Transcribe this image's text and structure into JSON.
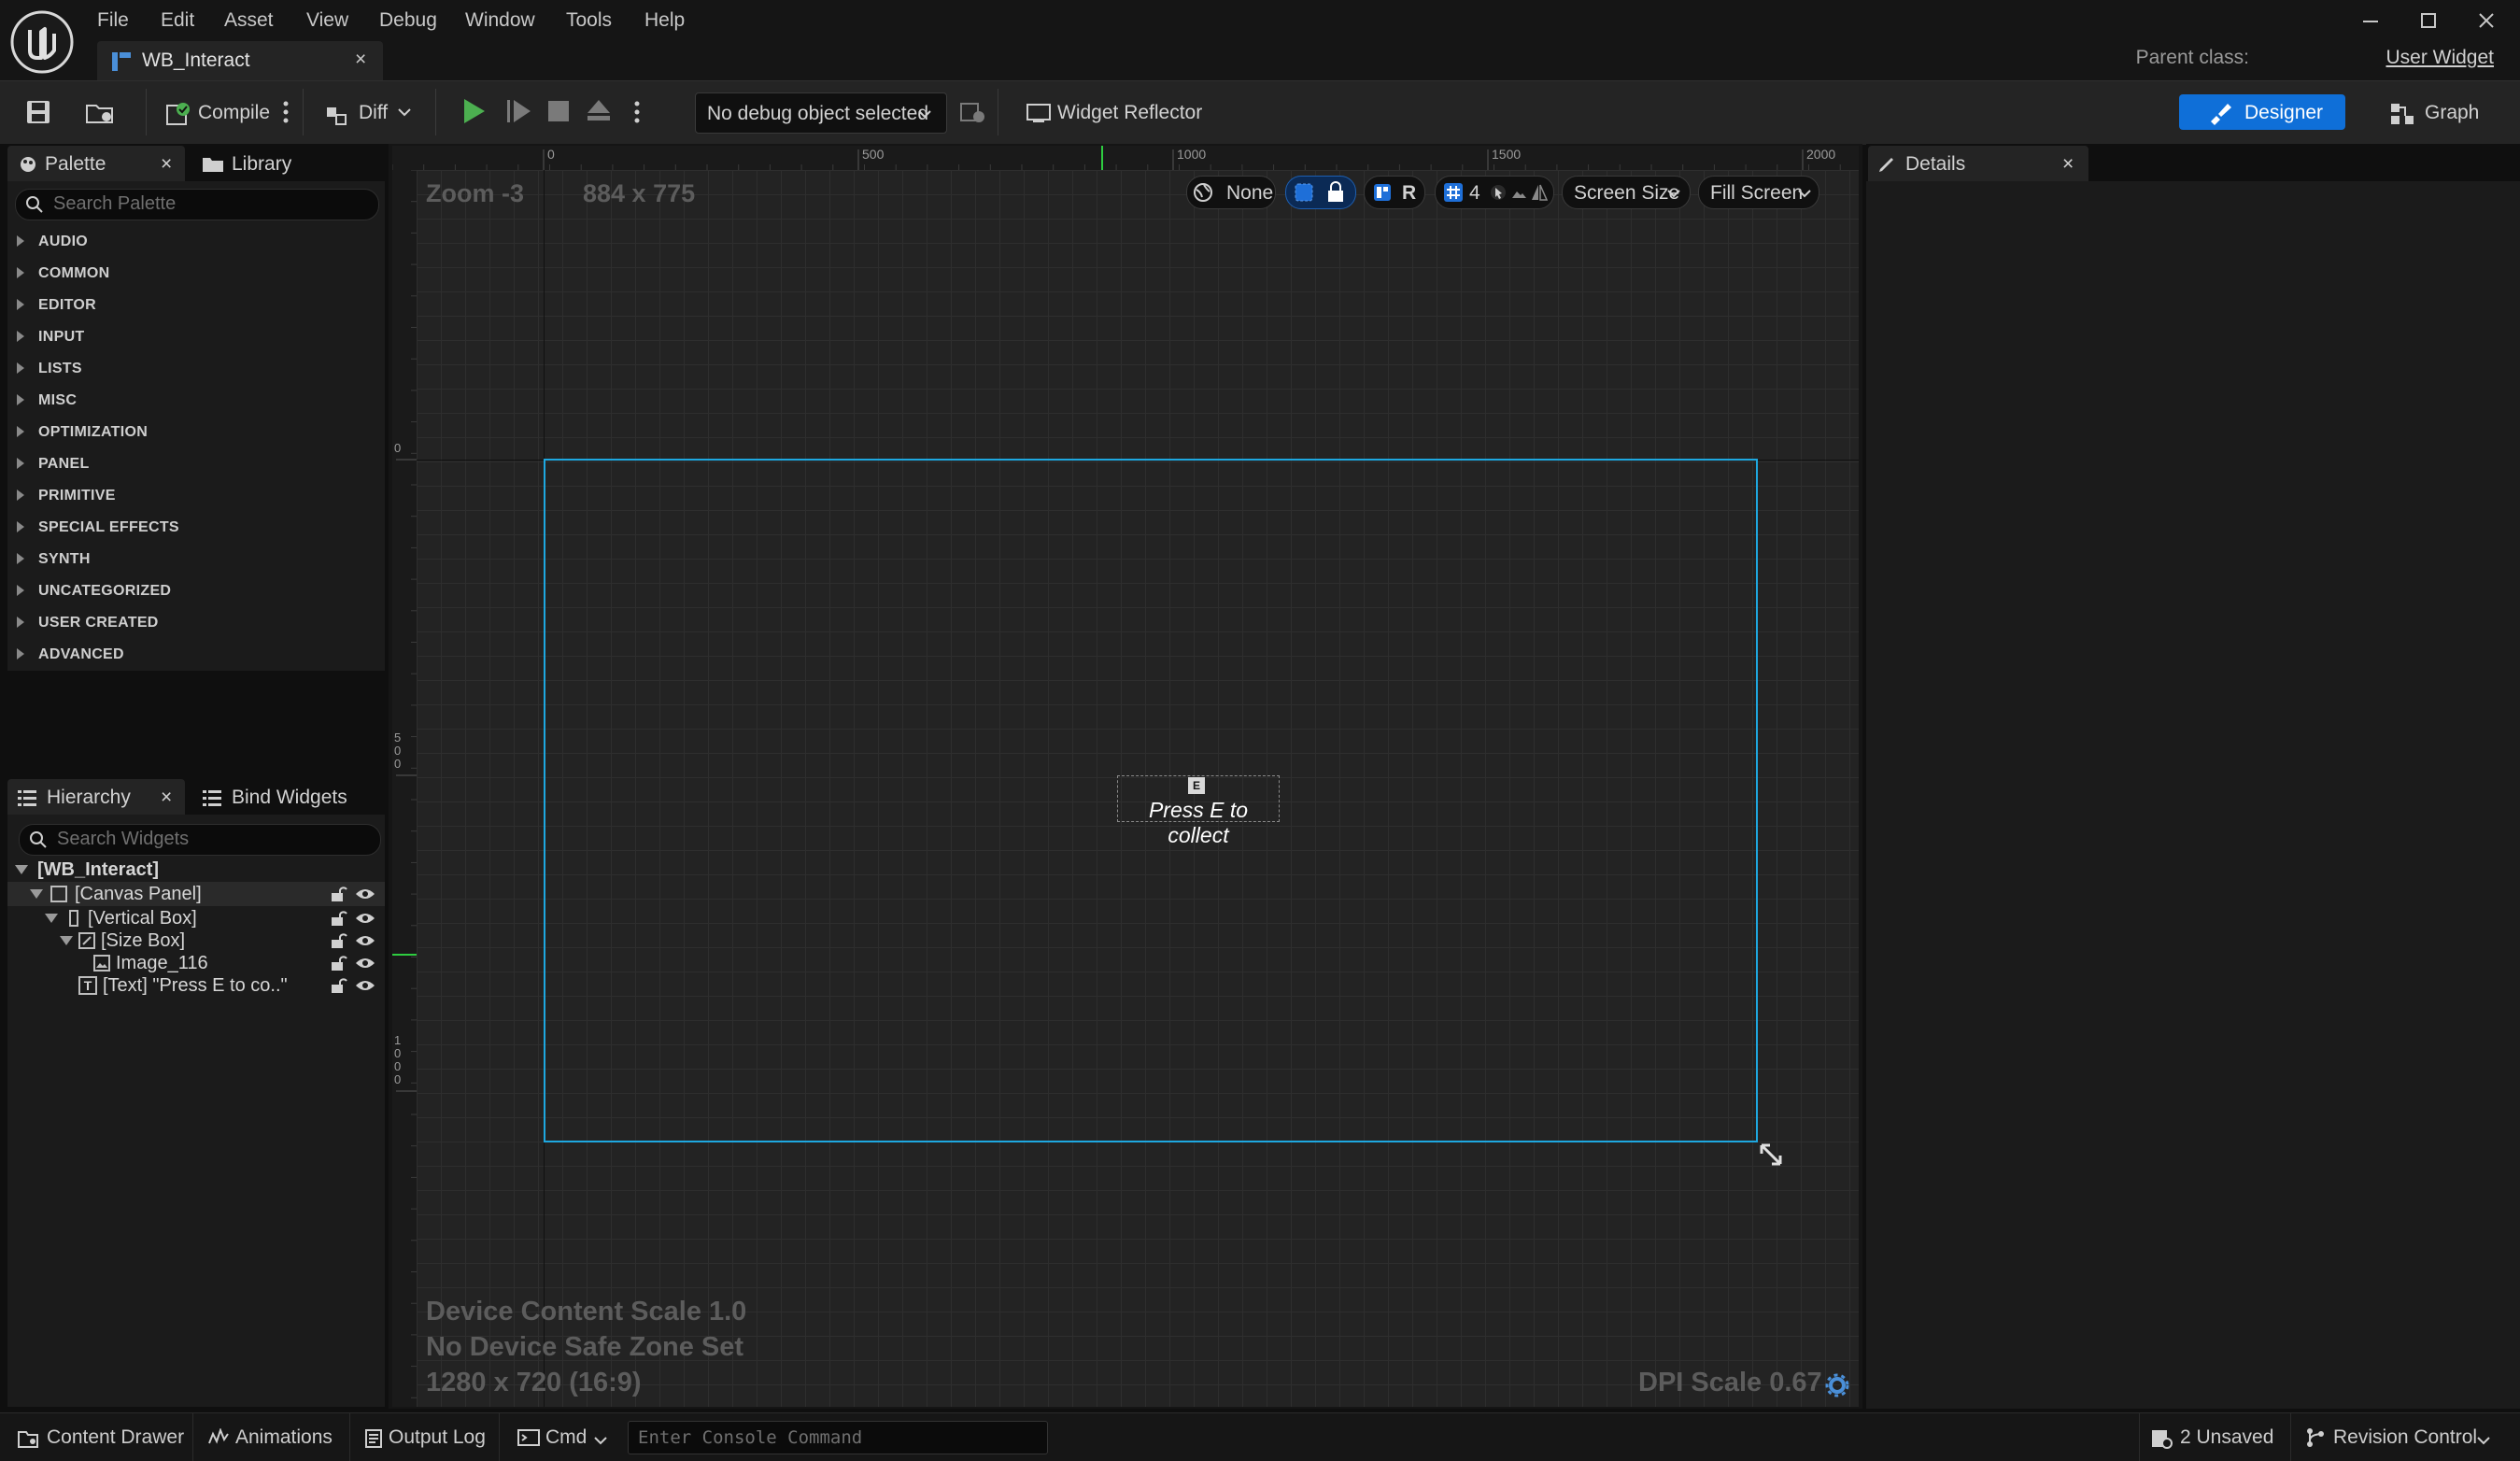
{
  "menu": [
    "File",
    "Edit",
    "Asset",
    "View",
    "Debug",
    "Window",
    "Tools",
    "Help"
  ],
  "document_tab": {
    "title": "WB_Interact",
    "close": "×"
  },
  "parent_class": {
    "label": "Parent class:",
    "value": "User Widget"
  },
  "toolbar": {
    "compile": "Compile",
    "diff": "Diff",
    "debug_object": "No debug object selected",
    "widget_reflector": "Widget Reflector",
    "designer": "Designer",
    "graph": "Graph"
  },
  "palette": {
    "tab_palette": "Palette",
    "tab_library": "Library",
    "close": "×",
    "search_placeholder": "Search Palette",
    "categories": [
      "AUDIO",
      "COMMON",
      "EDITOR",
      "INPUT",
      "LISTS",
      "MISC",
      "OPTIMIZATION",
      "PANEL",
      "PRIMITIVE",
      "SPECIAL EFFECTS",
      "SYNTH",
      "UNCATEGORIZED",
      "USER CREATED",
      "ADVANCED"
    ]
  },
  "hierarchy": {
    "tab_hierarchy": "Hierarchy",
    "tab_bind": "Bind Widgets",
    "close": "×",
    "search_placeholder": "Search Widgets",
    "root": "[WB_Interact]",
    "items": [
      "[Canvas Panel]",
      "[Vertical Box]",
      "[Size Box]",
      "Image_116",
      "[Text] \"Press E to co..\""
    ],
    "icon_labels": [
      "T"
    ]
  },
  "viewport": {
    "zoom": "Zoom -3",
    "size": "884 x 775",
    "ruler_h": [
      "0",
      "500",
      "1000",
      "1500",
      "2000"
    ],
    "ruler_v": [
      "0",
      "5\n0\n0",
      "1\n0\n0\n0"
    ],
    "toolbar": {
      "none": "None",
      "r": "R",
      "grid_size": "4",
      "screen_size": "Screen Size",
      "fill_screen": "Fill Screen"
    },
    "widget_key": "E",
    "widget_text": "Press E to collect",
    "device_content_scale": "Device Content Scale 1.0",
    "safe_zone": "No Device Safe Zone Set",
    "resolution": "1280 x 720 (16:9)",
    "dpi_scale": "DPI Scale 0.67"
  },
  "details": {
    "title": "Details",
    "close": "×"
  },
  "statusbar": {
    "content_drawer": "Content Drawer",
    "animations": "Animations",
    "output_log": "Output Log",
    "cmd": "Cmd",
    "console_placeholder": "Enter Console Command",
    "unsaved": "2 Unsaved",
    "revision_control": "Revision Control"
  },
  "colors": {
    "accent": "#0f6fd8",
    "selection_outline": "#1ea8e0",
    "background": "#0f0f0f",
    "panel": "#1b1b1b",
    "viewport": "#232323"
  }
}
